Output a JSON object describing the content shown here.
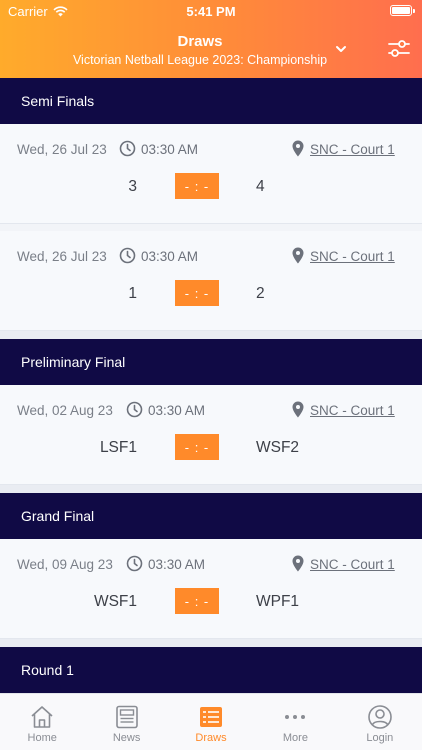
{
  "status_bar": {
    "carrier": "Carrier",
    "time": "5:41 PM"
  },
  "header": {
    "title": "Draws",
    "competition": "Victorian Netball League 2023: Championship",
    "chevron_icon": "chevron-down-icon",
    "filter_icon": "sliders-icon"
  },
  "colors": {
    "accent": "#ff8a2a",
    "round_header": "#100a45",
    "header_gradient_start": "#ffab2b",
    "header_gradient_end": "#ff6e4e"
  },
  "rounds": [
    {
      "name": "Semi Finals",
      "matches": [
        {
          "date": "Wed, 26 Jul 23",
          "time": "03:30 AM",
          "venue": "SNC - Court 1",
          "home": "3",
          "away": "4",
          "score": "- : -"
        },
        {
          "date": "Wed, 26 Jul 23",
          "time": "03:30 AM",
          "venue": "SNC - Court 1",
          "home": "1",
          "away": "2",
          "score": "- : -"
        }
      ]
    },
    {
      "name": "Preliminary Final",
      "matches": [
        {
          "date": "Wed, 02 Aug 23",
          "time": "03:30 AM",
          "venue": "SNC - Court 1",
          "home": "LSF1",
          "away": "WSF2",
          "score": "- : -"
        }
      ]
    },
    {
      "name": "Grand Final",
      "matches": [
        {
          "date": "Wed, 09 Aug 23",
          "time": "03:30 AM",
          "venue": "SNC - Court 1",
          "home": "WSF1",
          "away": "WPF1",
          "score": "- : -"
        }
      ]
    },
    {
      "name": "Round 1",
      "matches": []
    }
  ],
  "tabs": [
    {
      "label": "Home",
      "icon": "home-icon"
    },
    {
      "label": "News",
      "icon": "news-icon"
    },
    {
      "label": "Draws",
      "icon": "draws-icon",
      "active": true
    },
    {
      "label": "More",
      "icon": "more-icon"
    },
    {
      "label": "Login",
      "icon": "user-icon"
    }
  ]
}
